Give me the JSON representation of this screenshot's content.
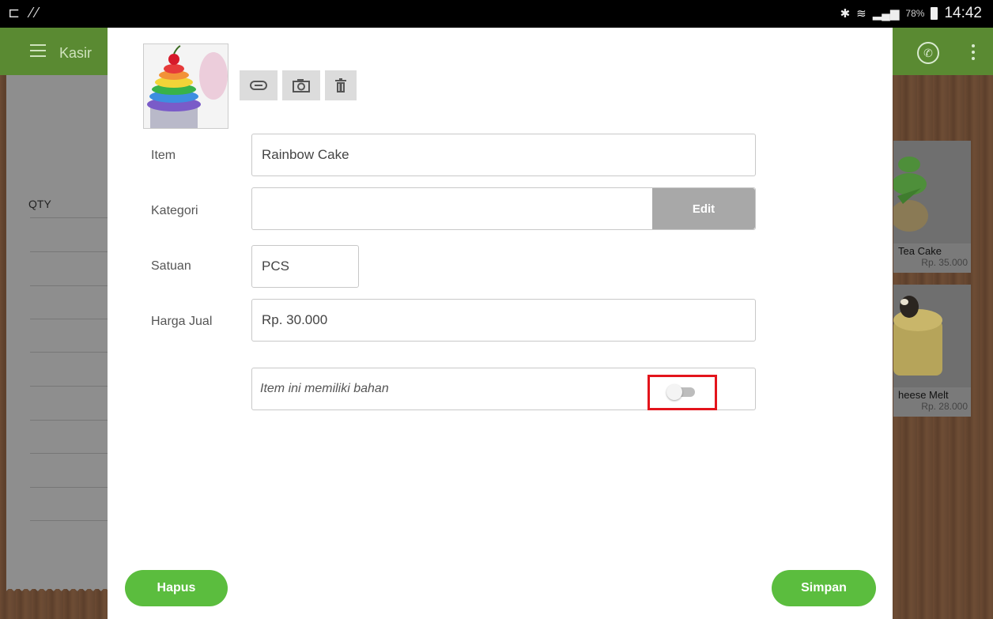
{
  "statusbar": {
    "battery_pct": "78%",
    "time": "14:42"
  },
  "app": {
    "title": "Kasir"
  },
  "receipt": {
    "qty_header": "QTY"
  },
  "products": [
    {
      "name": "Tea Cake",
      "price": "Rp. 35.000"
    },
    {
      "name": "heese Melt",
      "price": "Rp. 28.000"
    }
  ],
  "form": {
    "item_label": "Item",
    "item_value": "Rainbow Cake",
    "kategori_label": "Kategori",
    "kategori_value": "",
    "edit_label": "Edit",
    "satuan_label": "Satuan",
    "satuan_value": "PCS",
    "harga_label": "Harga Jual",
    "harga_value": "Rp. 30.000",
    "bahan_text": "Item ini memiliki bahan",
    "bahan_enabled": false
  },
  "buttons": {
    "hapus": "Hapus",
    "simpan": "Simpan"
  },
  "colors": {
    "primary_green": "#5bbd3e",
    "appbar_green": "#5a8a32",
    "highlight_red": "#e3141c"
  }
}
